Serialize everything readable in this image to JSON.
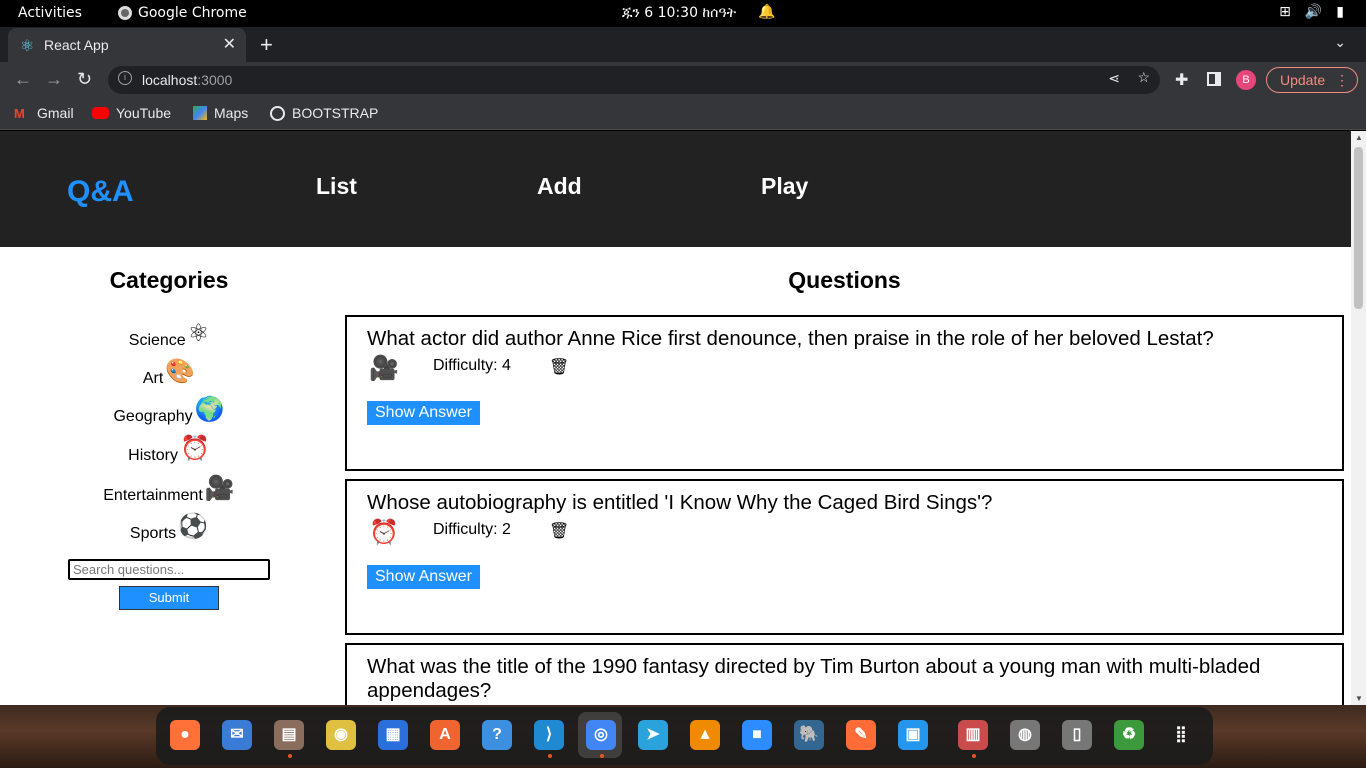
{
  "system": {
    "activities": "Activities",
    "app_name": "Google Chrome",
    "clock": "ጁን 6  10:30 ከሰዓት"
  },
  "browser": {
    "tab_title": "React App",
    "url_host": "localhost",
    "url_port": ":3000",
    "update_label": "Update",
    "profile_initial": "B",
    "bookmarks": [
      "Gmail",
      "YouTube",
      "Maps",
      "BOOTSTRAP"
    ]
  },
  "header": {
    "brand": "Q&A",
    "nav": [
      "List",
      "Add",
      "Play"
    ]
  },
  "sidebar": {
    "title": "Categories",
    "categories": [
      {
        "label": "Science",
        "icon": "atom-icon"
      },
      {
        "label": "Art",
        "icon": "palette-icon"
      },
      {
        "label": "Geography",
        "icon": "africa-icon"
      },
      {
        "label": "History",
        "icon": "alarm-clock-icon"
      },
      {
        "label": "Entertainment",
        "icon": "film-camera-icon"
      },
      {
        "label": "Sports",
        "icon": "soccer-ball-icon"
      }
    ],
    "search_placeholder": "Search questions...",
    "submit_label": "Submit"
  },
  "main": {
    "title": "Questions",
    "questions": [
      {
        "text": "What actor did author Anne Rice first denounce, then praise in the role of her beloved Lestat?",
        "difficulty": "Difficulty: 4",
        "category_icon": "film-camera-icon",
        "button": "Show Answer"
      },
      {
        "text": "Whose autobiography is entitled 'I Know Why the Caged Bird Sings'?",
        "difficulty": "Difficulty: 2",
        "category_icon": "alarm-clock-icon",
        "button": "Show Answer"
      },
      {
        "text": "What was the title of the 1990 fantasy directed by Tim Burton about a young man with multi-bladed appendages?"
      }
    ]
  },
  "dock": {
    "apps": [
      "firefox-icon",
      "thunderbird-icon",
      "files-icon",
      "rhythmbox-icon",
      "libreoffice-writer-icon",
      "app-center-icon",
      "help-icon",
      "vscode-icon",
      "chrome-icon",
      "telegram-icon",
      "vlc-icon",
      "zoom-icon",
      "postgresql-icon",
      "postman-icon",
      "docker-icon",
      "screenshot-viewer-icon",
      "disk-icon",
      "usb-drive-icon",
      "trash-icon",
      "show-apps-icon"
    ]
  }
}
